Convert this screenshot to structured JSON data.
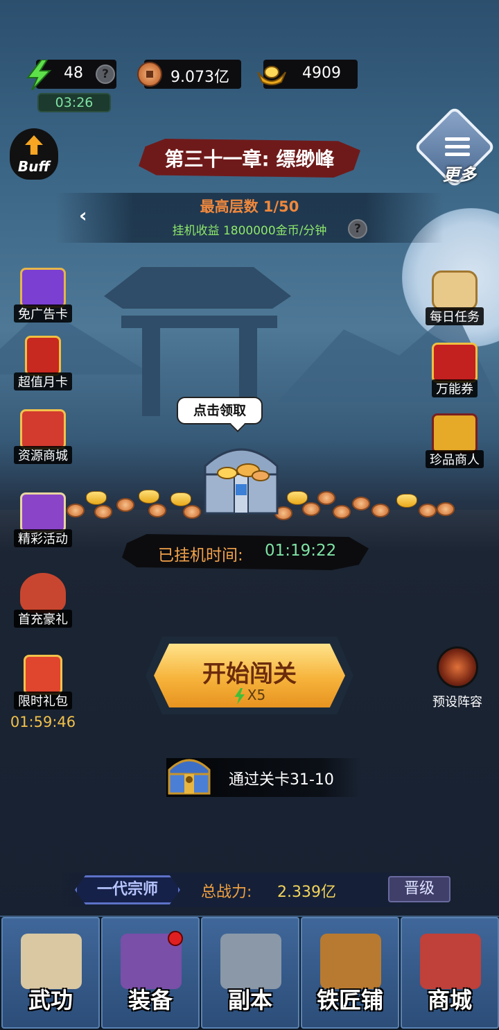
{
  "resources": {
    "energy": "48",
    "energy_timer": "03:26",
    "coins": "9.073亿",
    "ingots": "4909"
  },
  "header": {
    "buff_label": "Buff",
    "more_label": "更多",
    "chapter_title": "第三十一章: 缥缈峰",
    "max_floor": "最高层数 1/50",
    "idle_income": "挂机收益 1800000金币/分钟"
  },
  "left_menu": [
    {
      "label": "免广告卡",
      "color": "#7b3fd1"
    },
    {
      "label": "超值月卡",
      "color": "#c7281f"
    },
    {
      "label": "资源商城",
      "color": "#d23b2e"
    },
    {
      "label": "精彩活动",
      "color": "#8a44c8"
    },
    {
      "label": "首充豪礼",
      "color": "#c8462f"
    },
    {
      "label": "限时礼包",
      "color": "#e0452e"
    }
  ],
  "gift_timer": "01:59:46",
  "right_menu": [
    {
      "label": "每日任务",
      "color": "#e8c98a"
    },
    {
      "label": "万能券",
      "color": "#c32020"
    },
    {
      "label": "珍品商人",
      "color": "#e6a928"
    }
  ],
  "idle": {
    "claim_bubble": "点击领取",
    "label": "已挂机时间:",
    "time": "01:19:22"
  },
  "start": {
    "label": "开始闯关",
    "cost": "X5"
  },
  "preset_label": "预设阵容",
  "reward_text": "通过关卡31-10",
  "rank": {
    "title": "一代宗师",
    "power_label": "总战力:",
    "power_value": "2.339亿",
    "promote": "晋级"
  },
  "nav": [
    {
      "label": "武功",
      "color": "#d9c8a2"
    },
    {
      "label": "装备",
      "color": "#7a4fa8"
    },
    {
      "label": "副本",
      "color": "#8a98a8"
    },
    {
      "label": "铁匠铺",
      "color": "#b87a30"
    },
    {
      "label": "商城",
      "color": "#c0403a"
    }
  ]
}
